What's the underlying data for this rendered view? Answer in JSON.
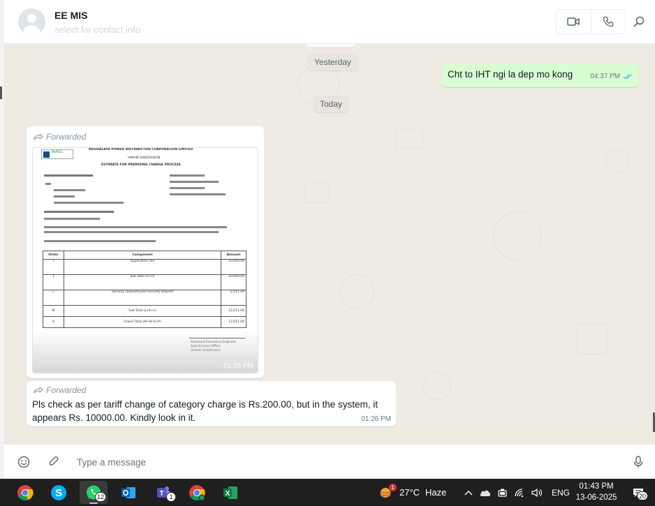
{
  "header": {
    "contact_name": "EE MIS",
    "contact_subtitle": "select for contact info"
  },
  "chat": {
    "date_yesterday": "Yesterday",
    "date_today": "Today",
    "messages": [
      {
        "direction": "outgoing",
        "text": "Cht to IHT ngi la dep mo kong",
        "time": "04:37 PM",
        "status": "read"
      },
      {
        "direction": "incoming",
        "forwarded_label": "Forwarded",
        "type": "image",
        "time": "01:26 PM",
        "document": {
          "org": "MEGHALAYA POWER DISTRIBUTION CORPORATION LIMITED",
          "sub": "UMIAM SUBDIVISION",
          "title": "ESTIMATE FOR PREMISING CHARGE PROCESS",
          "table_headers": [
            "Order",
            "Component",
            "Amount"
          ],
          "table_rows": [
            [
              "I",
              "Application Fee",
              "10,000.00"
            ],
            [
              "J",
              "Sub Total (I)+(I)",
              "10,000.00"
            ],
            [
              "L",
              "Security Deposit(Load Security Deposit",
              "2,011.00"
            ],
            [
              "M",
              "Sub Total (J+K+L)",
              "12,011.00"
            ],
            [
              "O",
              "Grand Total (M+N-O+P)",
              "12,011.00"
            ]
          ],
          "signature_lines": [
            "Assistant Executive Engineer",
            "Sub Division Office",
            "Umiam Subdivision"
          ]
        }
      },
      {
        "direction": "incoming",
        "forwarded_label": "Forwarded",
        "text_line1": "Pls check as per tariff change of category charge is Rs.200.00, but in the system, it",
        "text_line2": "appears Rs. 10000.00. Kindly look in it.",
        "time": "01:26 PM"
      }
    ]
  },
  "composer": {
    "placeholder": "Type a message"
  },
  "taskbar": {
    "apps": [
      {
        "name": "chrome",
        "badge": ""
      },
      {
        "name": "skype",
        "badge": ""
      },
      {
        "name": "whatsapp",
        "badge": "12"
      },
      {
        "name": "outlook",
        "badge": ""
      },
      {
        "name": "teams",
        "badge": "1"
      },
      {
        "name": "chrome-profile",
        "badge": ""
      },
      {
        "name": "excel",
        "badge": ""
      }
    ],
    "weather": {
      "badge": "1",
      "temp": "27°C",
      "condition": "Haze"
    },
    "language": "ENG",
    "time": "01:43 PM",
    "date": "13-06-2025",
    "notification_count": "20"
  },
  "colors": {
    "outgoing_bubble": "#d9fdd3",
    "chat_background": "#efeae2",
    "read_ticks": "#53bdeb",
    "taskbar": "#1f1f1f"
  }
}
